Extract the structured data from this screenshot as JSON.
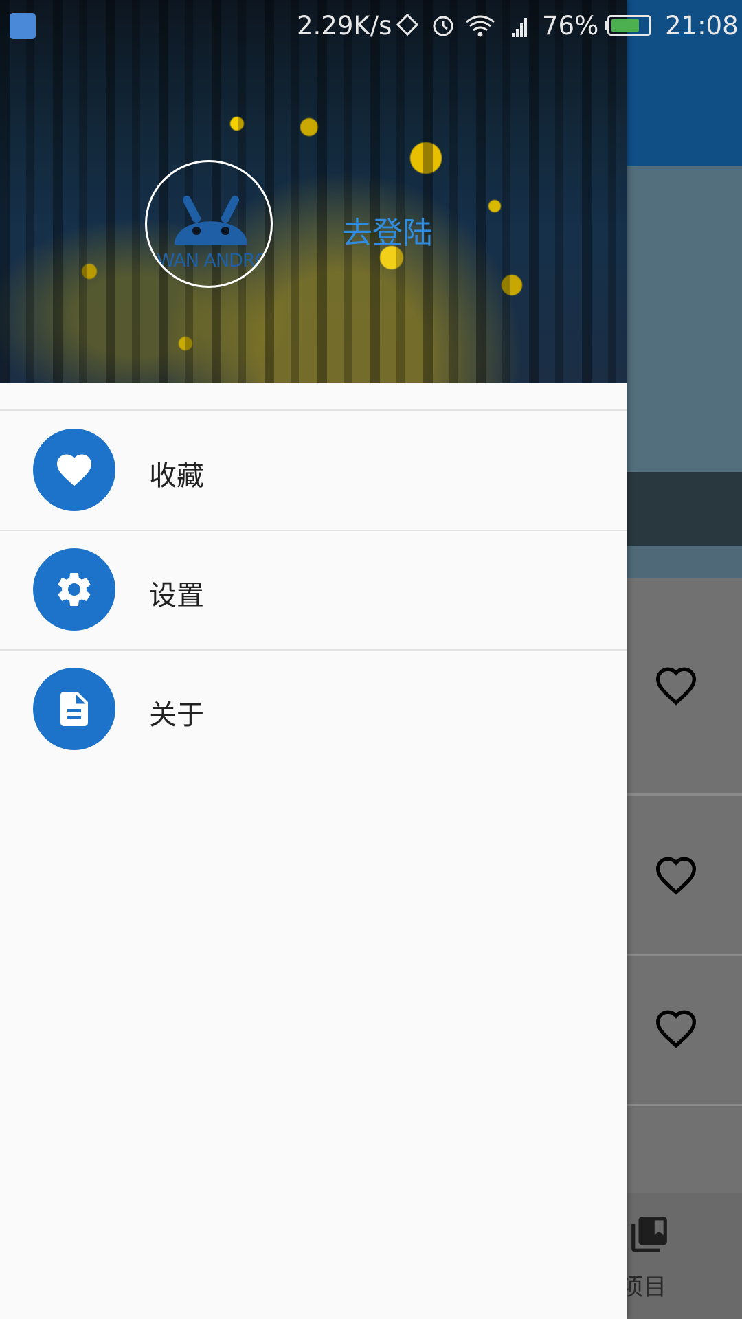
{
  "status_bar": {
    "net_speed": "2.29K/s",
    "battery_percent": "76%",
    "battery_level": 0.76,
    "time": "21:08"
  },
  "drawer": {
    "avatar_text": "WAN ANDROID",
    "login_label": "去登陆",
    "menu": [
      {
        "label": "收藏",
        "icon": "heart-icon"
      },
      {
        "label": "设置",
        "icon": "gear-icon"
      },
      {
        "label": "关于",
        "icon": "document-icon"
      }
    ]
  },
  "background_app": {
    "bottom_nav_label": "项目"
  },
  "colors": {
    "accent": "#1d72c9",
    "login_text": "#2f8ce0",
    "toolbar": "#0f4f86"
  }
}
